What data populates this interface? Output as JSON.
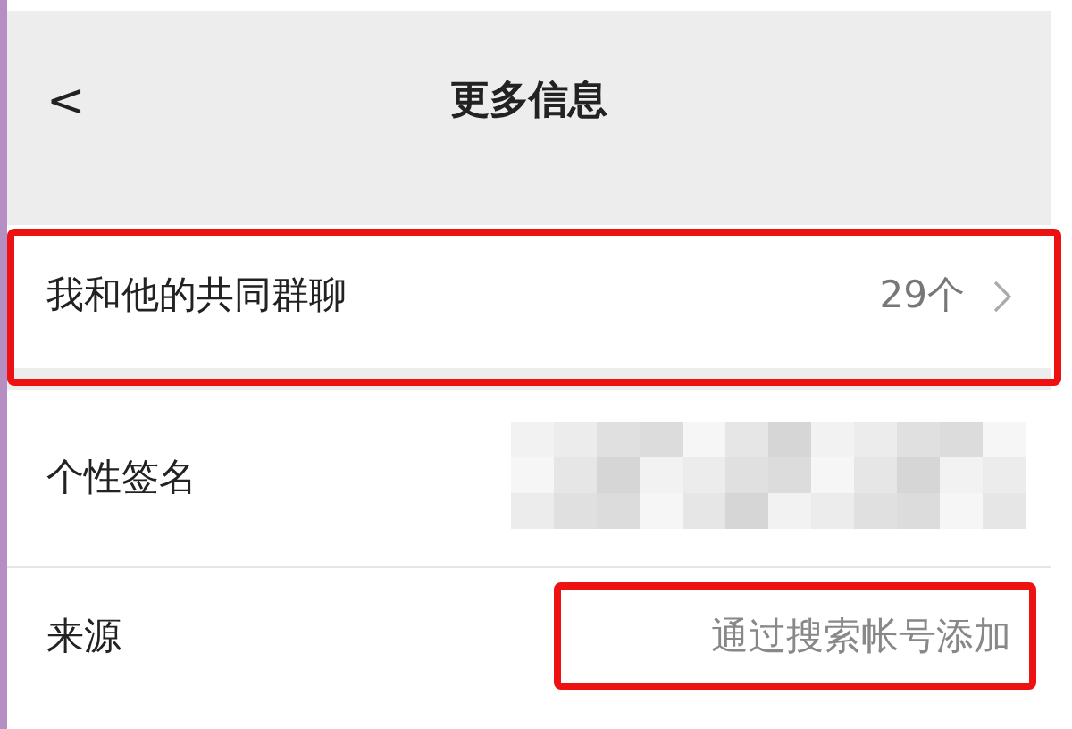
{
  "header": {
    "back": "<",
    "title": "更多信息"
  },
  "rows": [
    {
      "kind": "link",
      "label": "我和他的共同群聊",
      "value": "29个",
      "highlighted": true
    },
    {
      "kind": "blurred",
      "label": "个性签名",
      "highlighted": false
    },
    {
      "kind": "text",
      "label": "来源",
      "value": "通过搜索帐号添加",
      "highlighted": true
    }
  ]
}
